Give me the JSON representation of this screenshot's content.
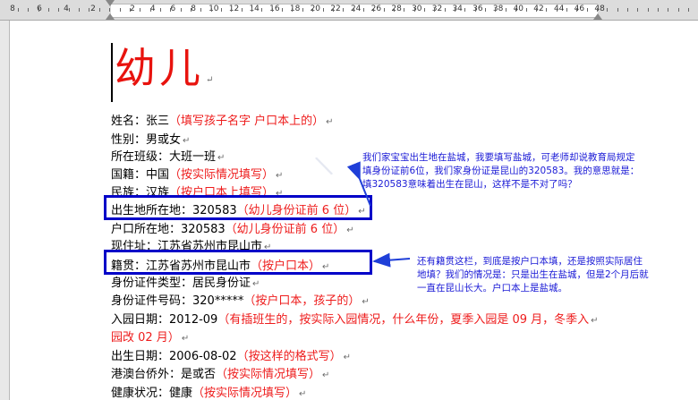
{
  "ruler": {
    "numbers_left": [
      "8",
      "6",
      "4",
      "2"
    ],
    "numbers_right": [
      "2",
      "4",
      "6",
      "8",
      "10",
      "12",
      "14",
      "16",
      "18",
      "20",
      "22",
      "24",
      "26",
      "28",
      "30",
      "32",
      "34",
      "36",
      "38",
      "40",
      "42",
      "44",
      "46",
      "48"
    ]
  },
  "document": {
    "title": "幼儿",
    "fields": [
      {
        "label": "姓名：",
        "value": "张三",
        "hint": "（填写孩子名字  户口本上的）"
      },
      {
        "label": "性别：",
        "value": "男或女",
        "hint": ""
      },
      {
        "label": "所在班级：",
        "value": "大班一班",
        "hint": ""
      },
      {
        "label": "国籍：",
        "value": "中国",
        "hint": "（按实际情况填写）"
      },
      {
        "label": "民族：",
        "value": "汉族",
        "hint": "（按户口本上填写）"
      },
      {
        "label": "出生地所在地：",
        "value": "320583",
        "hint": "（幼儿身份证前 6 位）"
      },
      {
        "label": "户口所在地：",
        "value": "320583",
        "hint": "（幼儿身份证前 6 位）"
      },
      {
        "label": "现住址：",
        "value": "江苏省苏州市昆山市",
        "hint": ""
      },
      {
        "label": "籍贯：",
        "value": "江苏省苏州市昆山市",
        "hint": "（按户口本）"
      },
      {
        "label": "身份证件类型：",
        "value": "居民身份证",
        "hint": ""
      },
      {
        "label": "身份证件号码：",
        "value": "320*****",
        "hint": "（按户口本，孩子的）"
      },
      {
        "label": "入园日期：",
        "value": "2012-09",
        "hint": "（有插班生的，按实际入园情况，什么年份，夏季入园是 09 月，冬季入"
      },
      {
        "label": "",
        "value": "",
        "hint": "园改 02 月）"
      },
      {
        "label": "出生日期：",
        "value": "2006-08-02",
        "hint": "（按这样的格式写）"
      },
      {
        "label": "港澳台侨外：",
        "value": "是或否",
        "hint": "（按实际情况填写）"
      },
      {
        "label": "健康状况：",
        "value": "健康",
        "hint": "（按实际情况填写）"
      }
    ]
  },
  "annotations": {
    "note1": [
      "我们家宝宝出生地在盐城，我要填写盐城，可老师却说教育局规定",
      "填身份证前6位，我们家身份证是昆山的320583。我的意思就是：",
      "填320583意味着出生在昆山，这样不是不对了吗？"
    ],
    "note2": [
      "还有籍贯这栏，到底是按户口本填，还是按照实际居住",
      "地填？我们的情况是：只是出生在盐城，但是2个月后就",
      "一直在昆山长大。户口本上是盐城。"
    ]
  },
  "colors": {
    "hint": "#ee1c1c",
    "title": "#e8130e",
    "annotation": "#1a1ad6",
    "box": "#0000c8"
  }
}
